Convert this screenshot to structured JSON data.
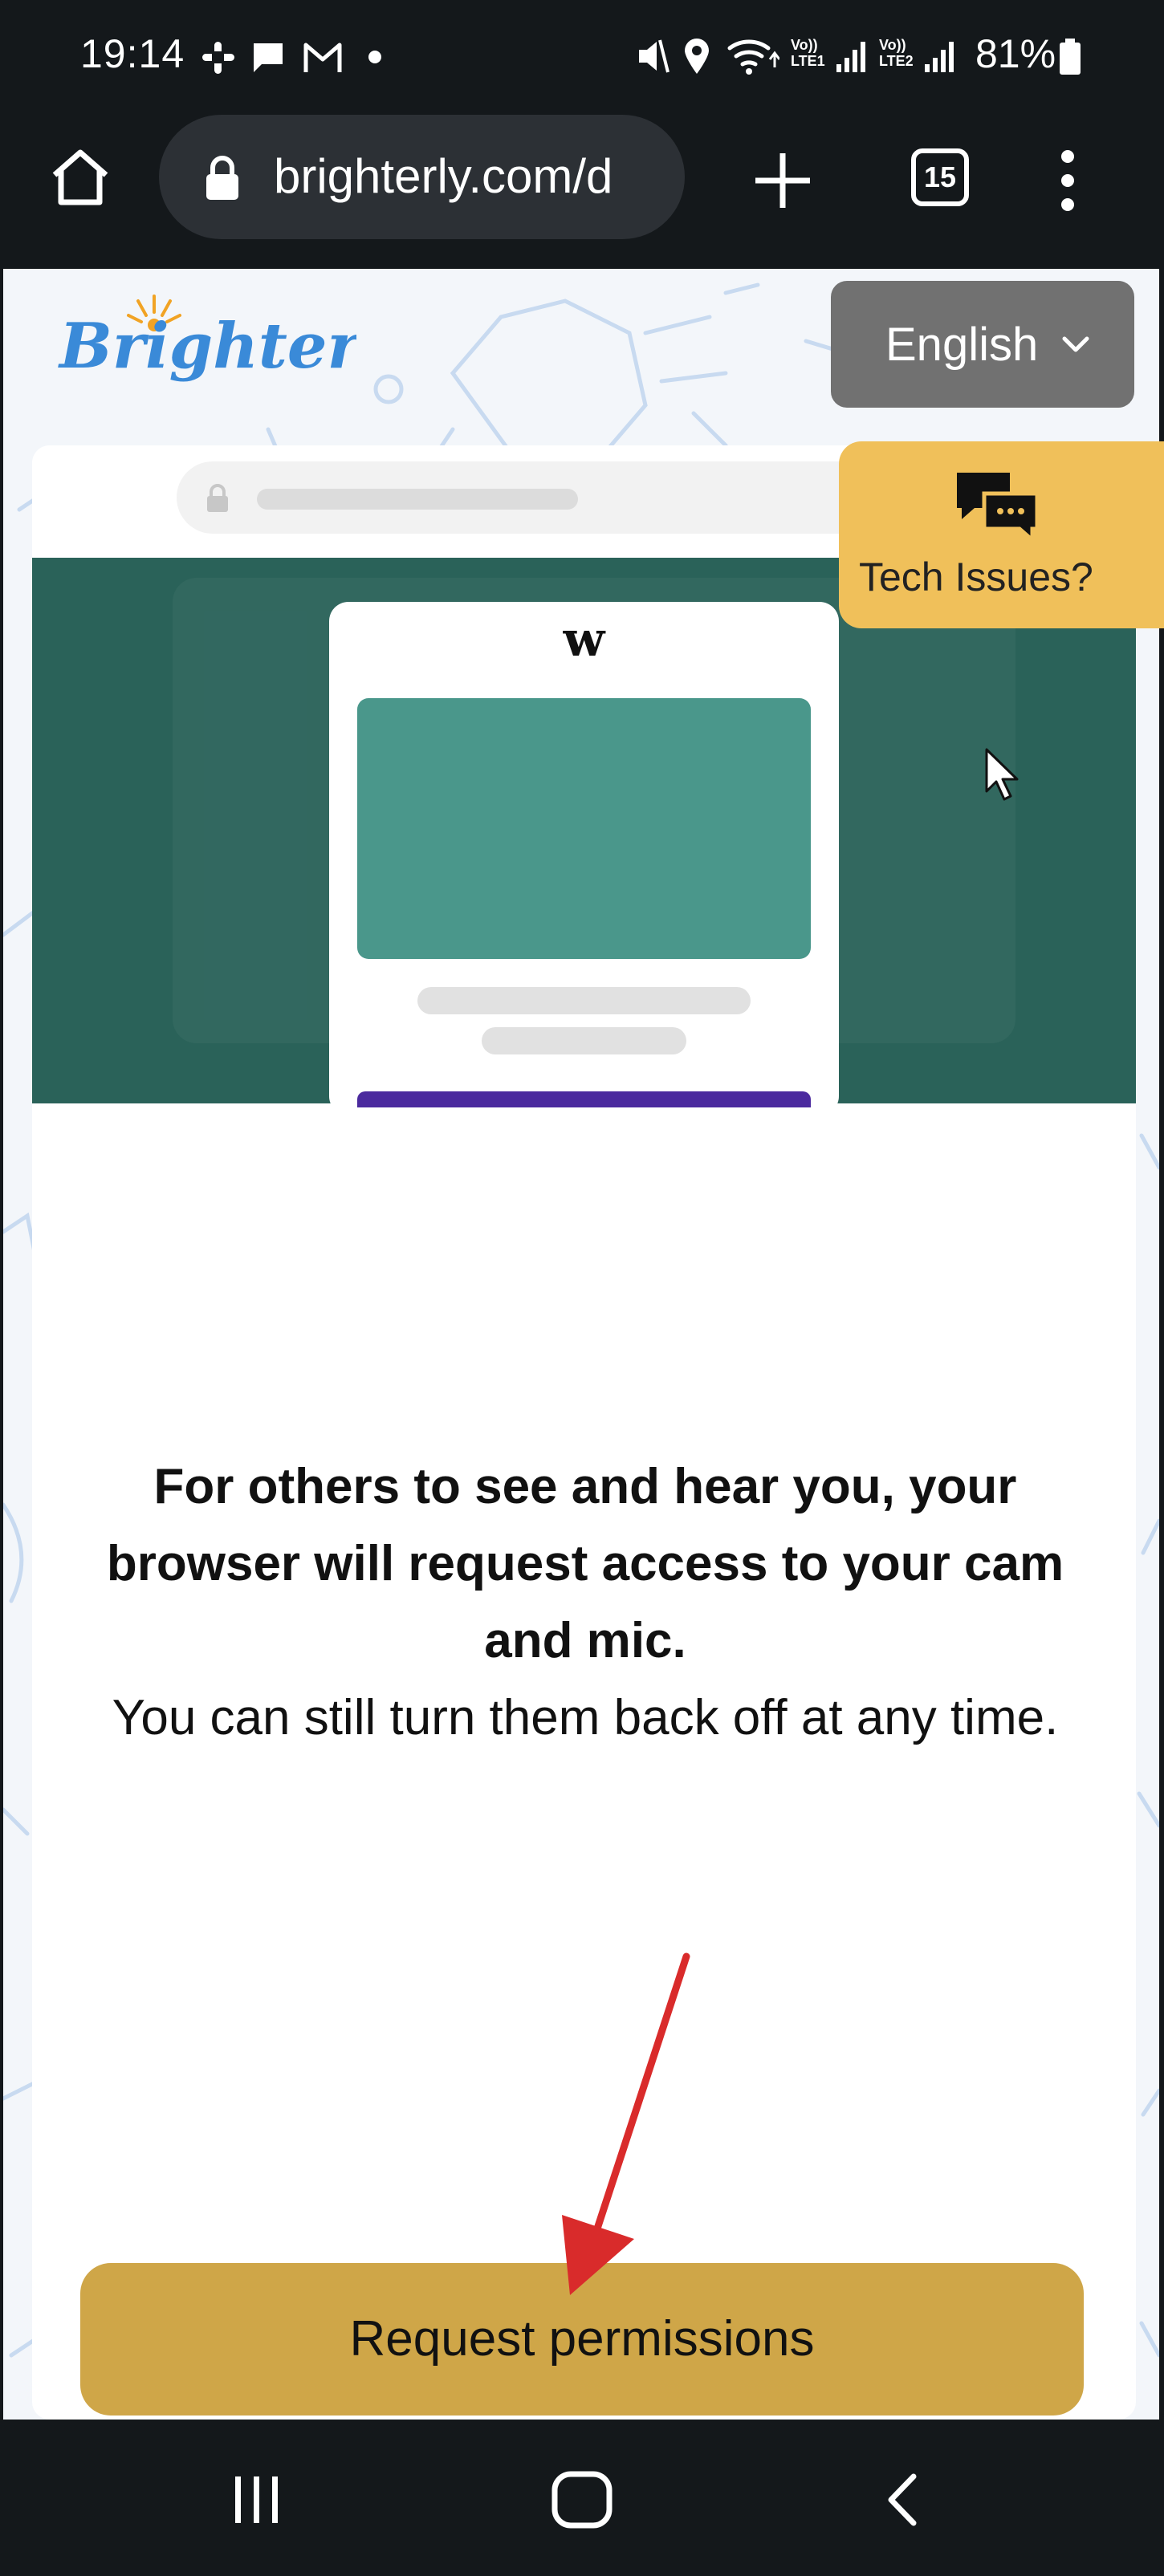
{
  "status_bar": {
    "time": "19:14",
    "battery": "81%",
    "icons": [
      "slack-icon",
      "message-icon",
      "gmail-icon",
      "dot-icon",
      "mute-icon",
      "location-icon",
      "wifi-icon",
      "lte1-signal-icon",
      "lte2-signal-icon",
      "battery-icon"
    ],
    "lte1": "Vo)) LTE1",
    "lte2": "Vo)) LTE2"
  },
  "browser": {
    "url": "brighterly.com/d",
    "tab_count": "15"
  },
  "page": {
    "logo_text": "Brighterly",
    "language_button": "English",
    "tech_issues_button": "Tech Issues?",
    "message_bold": "For others to see and hear you, your browser will request access to your cam and mic.",
    "message_regular": "You can still turn them back off at any time.",
    "request_button": "Request permissions",
    "illustration_logo": "w"
  },
  "colors": {
    "teal": "#2a6259",
    "teal_light": "#4a978b",
    "request_button": "#cfa648",
    "tech_button": "#f0c05a",
    "logo_blue": "#3a8ad8",
    "arrow_red": "#d92b2b"
  }
}
